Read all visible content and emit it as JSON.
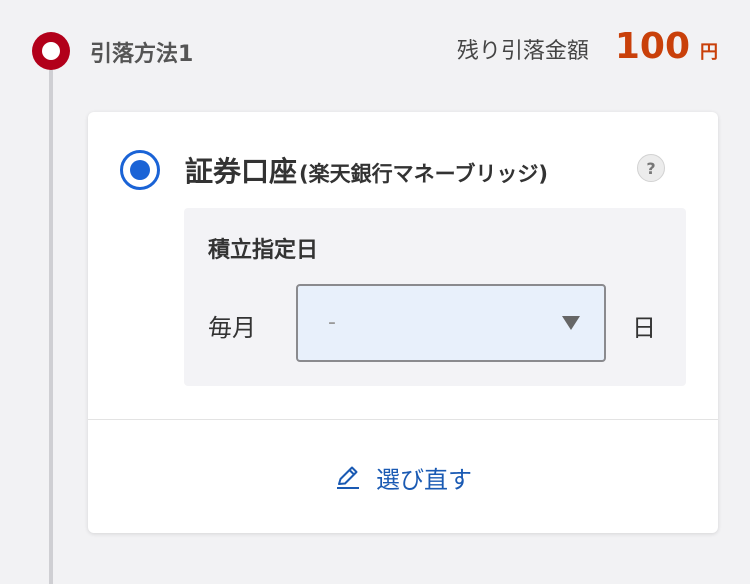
{
  "step": {
    "label": "引落方法1",
    "remaining_label": "残り引落金額",
    "remaining_amount": "100",
    "remaining_unit": "円"
  },
  "option": {
    "title_main": "証券口座",
    "title_sub": "(楽天銀行マネーブリッジ)",
    "help_icon": "question-icon",
    "selected": true
  },
  "date_setting": {
    "heading": "積立指定日",
    "prefix": "毎月",
    "select_value": "-",
    "suffix": "日"
  },
  "actions": {
    "reselect_label": "選び直す",
    "reselect_icon": "pencil-icon"
  },
  "colors": {
    "accent_red": "#b2001a",
    "amount_orange": "#c9400a",
    "radio_blue": "#1a63d6",
    "link_blue": "#1a5ab3"
  }
}
